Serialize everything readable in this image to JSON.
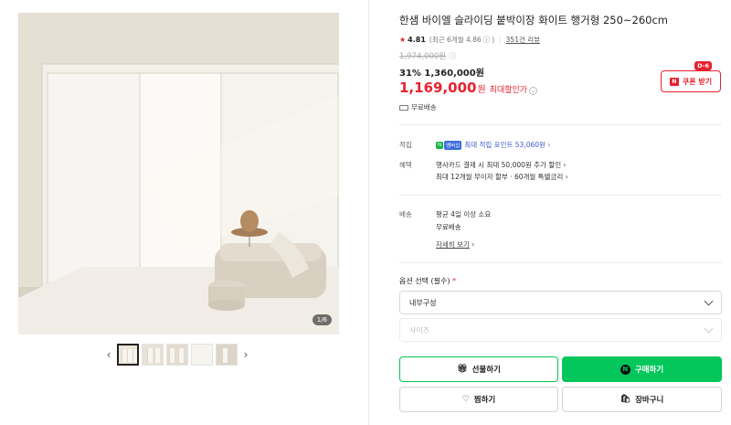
{
  "gallery": {
    "page_counter": "1/6",
    "prev_label": "‹",
    "next_label": "›",
    "thumb_count": 5
  },
  "product": {
    "title": "한샘 바이엘 슬라이딩 붙박이장 화이트 행거형 250~260cm",
    "rating": "4.81",
    "rating_recent": "(최근 6개월 4.86",
    "rating_recent_close": ")",
    "review_count": "351건 리뷰",
    "original_price": "1,974,000원",
    "discount_line": "31% 1,360,000원",
    "final_price": "1,169,000",
    "final_won": "원",
    "max_discount_label": "최대할인가",
    "coupon_dday": "D-6",
    "coupon_label": "쿠폰 받기",
    "shipping_summary": "무료배송"
  },
  "details": {
    "points_label": "적립",
    "points_badge1": "N",
    "points_badge2": "멤버십",
    "points_text": "최대 적립 포인트 53,060원",
    "benefits_label": "혜택",
    "benefit_1": "행사카드 결제 시 최대 50,000원 추가 할인",
    "benefit_2": "최대 12개월 무이자 할부 · 60개월 특별금리",
    "delivery_label": "배송",
    "delivery_1": "평균 4일 이상 소요",
    "delivery_2": "무료배송",
    "delivery_more": "자세히 보기"
  },
  "options": {
    "label": "옵션 선택 (필수)",
    "required_mark": "*",
    "select_1": "내부구성",
    "select_2": "사이즈"
  },
  "actions": {
    "gift": "선물하기",
    "buy": "구매하기",
    "wish": "찜하기",
    "cart": "장바구니"
  },
  "colors": {
    "accent_red": "#e8212f",
    "naver_green": "#03c75a"
  }
}
